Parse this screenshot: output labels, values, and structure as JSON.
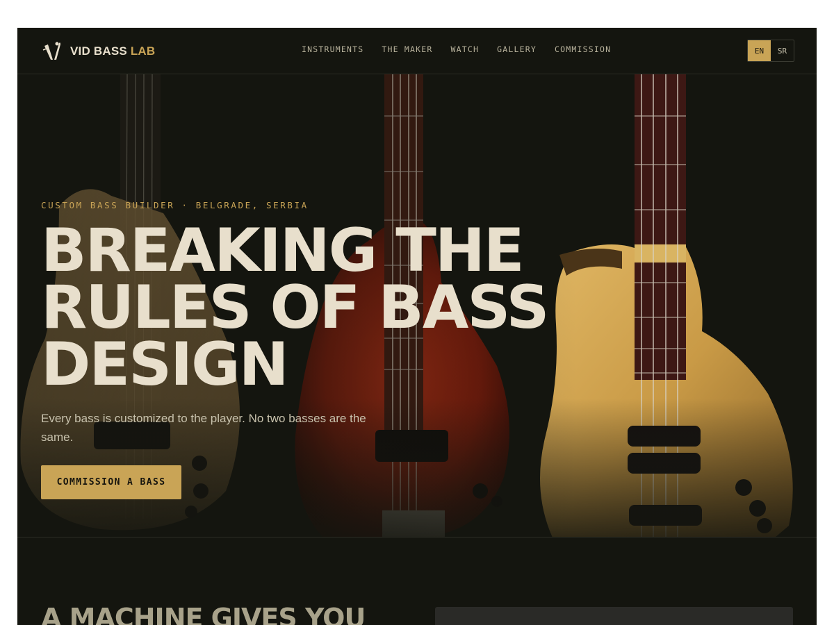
{
  "brand": {
    "name_main": "VID BASS",
    "name_accent": "LAB",
    "logo_icon": "v-tuning-fork-icon"
  },
  "nav": {
    "links": [
      "INSTRUMENTS",
      "THE MAKER",
      "WATCH",
      "GALLERY",
      "COMMISSION"
    ],
    "languages": [
      "EN",
      "SR"
    ],
    "active_language": "EN"
  },
  "hero": {
    "eyebrow": "CUSTOM BASS BUILDER · BELGRADE, SERBIA",
    "headline": "BREAKING THE RULES OF BASS DESIGN",
    "subtext": "Every bass is customized to the player. No two basses are the same.",
    "cta_label": "COMMISSION A BASS",
    "background_image": "three-custom-bass-guitars-photo"
  },
  "next_section": {
    "title_partial": "A MACHINE GIVES YOU"
  },
  "colors": {
    "background": "#14150f",
    "accent": "#c9a456",
    "text": "#e8dfcc",
    "muted": "#c8c2ad"
  }
}
